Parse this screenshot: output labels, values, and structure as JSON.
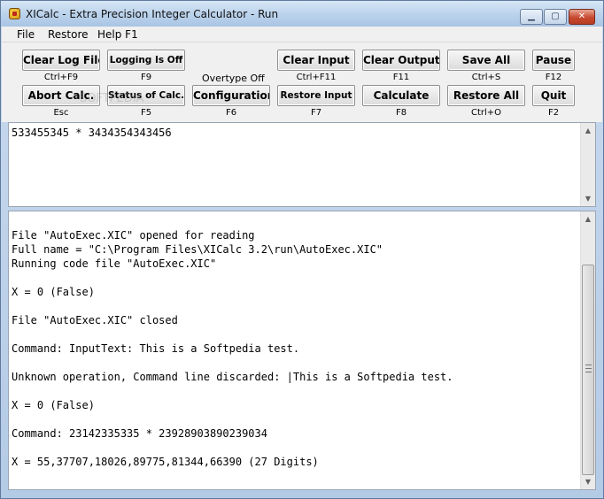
{
  "window": {
    "title": "XICalc - Extra Precision Integer Calculator - Run",
    "controls": {
      "minimize": "▁",
      "maximize": "▢",
      "close": "✕"
    }
  },
  "menu": [
    "File",
    "Restore",
    "Help F1"
  ],
  "watermark": "SOFTPEDIA",
  "toolbar": {
    "row1": [
      {
        "label": "Clear Log File",
        "hint": "Ctrl+F9"
      },
      {
        "label": "Logging Is Off",
        "hint": "F9"
      },
      {
        "label": "Clear Input",
        "hint": "Ctrl+F11"
      },
      {
        "label": "Clear Output",
        "hint": "F11"
      },
      {
        "label": "Save All",
        "hint": "Ctrl+S"
      },
      {
        "label": "Pause",
        "hint": "F12"
      }
    ],
    "overtype": "Overtype Off",
    "row2": [
      {
        "label": "Abort Calc.",
        "hint": "Esc"
      },
      {
        "label": "Status of Calc.",
        "hint": "F5"
      },
      {
        "label": "Configuration",
        "hint": "F6"
      },
      {
        "label": "Restore Input",
        "hint": "F7"
      },
      {
        "label": "Calculate",
        "hint": "F8"
      },
      {
        "label": "Restore All",
        "hint": "Ctrl+O"
      },
      {
        "label": "Quit",
        "hint": "F2"
      }
    ]
  },
  "input_text": "533455345 * 3434354343456",
  "output_lines": [
    "",
    "File \"AutoExec.XIC\" opened for reading",
    "Full name = \"C:\\Program Files\\XICalc 3.2\\run\\AutoExec.XIC\"",
    "Running code file \"AutoExec.XIC\"",
    "",
    "X = 0 (False)",
    "",
    "File \"AutoExec.XIC\" closed",
    "",
    "Command: InputText: This is a Softpedia test.",
    "",
    "Unknown operation, Command line discarded: |This is a Softpedia test.",
    "",
    "X = 0 (False)",
    "",
    "Command: 23142335335 * 23928903890239034",
    "",
    "X = 55,37707,18026,89775,81344,66390 (27 Digits)"
  ],
  "scroll_icons": {
    "up": "▲",
    "down": "▼"
  }
}
